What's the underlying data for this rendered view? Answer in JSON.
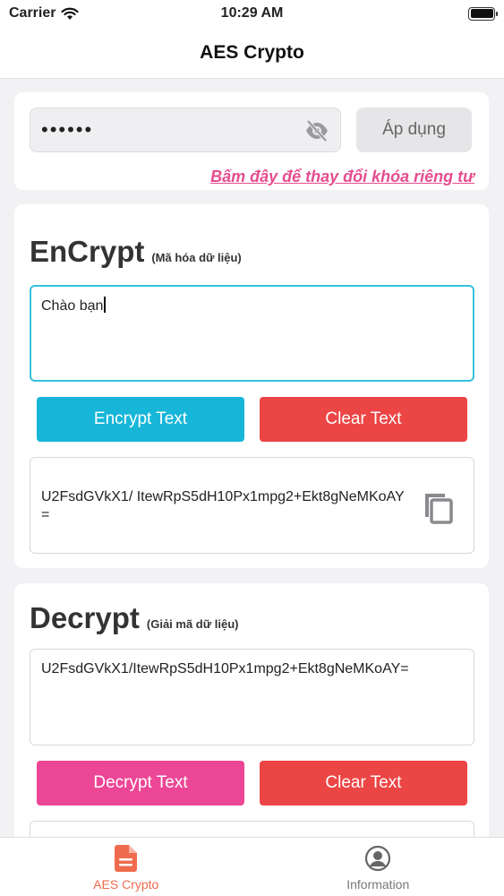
{
  "status_bar": {
    "carrier": "Carrier",
    "time": "10:29 AM"
  },
  "nav": {
    "title": "AES Crypto"
  },
  "key_section": {
    "key_value": "••••••",
    "apply_label": "Áp dụng",
    "change_link": "Bấm đây để thay đổi khóa riêng tư"
  },
  "encrypt": {
    "title": "EnCrypt",
    "subtitle": "(Mã hóa dữ liệu)",
    "input_value": "Chào bạn",
    "encrypt_label": "Encrypt Text",
    "clear_label": "Clear Text",
    "output_value": "U2FsdGVkX1/ ItewRpS5dH10Px1mpg2+Ekt8gNeMKoAY="
  },
  "decrypt": {
    "title": "Decrypt",
    "subtitle": "(Giải mã dữ liệu)",
    "input_value": "U2FsdGVkX1/ItewRpS5dH10Px1mpg2+Ekt8gNeMKoAY=",
    "decrypt_label": "Decrypt Text",
    "clear_label": "Clear Text"
  },
  "tabs": [
    {
      "label": "AES Crypto",
      "icon": "document-icon",
      "active": true
    },
    {
      "label": "Information",
      "icon": "user-circle-icon",
      "active": false
    }
  ],
  "colors": {
    "accent_cyan": "#17b6d8",
    "accent_red": "#ec4545",
    "accent_pink": "#ec4696",
    "link_pink": "#e54d8f",
    "tab_active": "#ef6b4e"
  }
}
